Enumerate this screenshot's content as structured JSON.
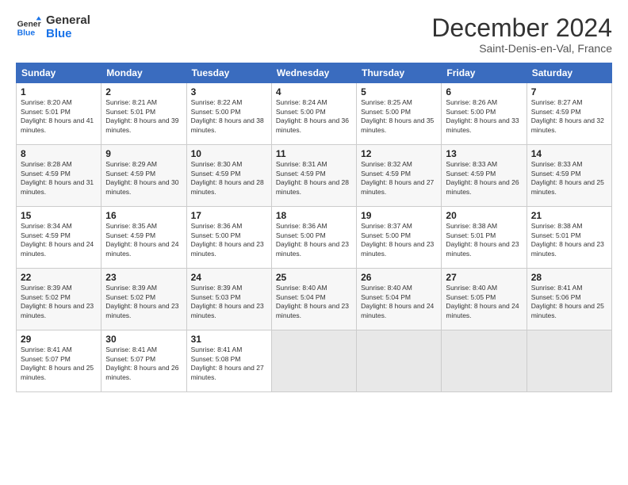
{
  "logo": {
    "line1": "General",
    "line2": "Blue"
  },
  "header": {
    "month": "December 2024",
    "location": "Saint-Denis-en-Val, France"
  },
  "days_of_week": [
    "Sunday",
    "Monday",
    "Tuesday",
    "Wednesday",
    "Thursday",
    "Friday",
    "Saturday"
  ],
  "weeks": [
    [
      {
        "day": "1",
        "sunrise": "8:20 AM",
        "sunset": "5:01 PM",
        "daylight": "8 hours and 41 minutes."
      },
      {
        "day": "2",
        "sunrise": "8:21 AM",
        "sunset": "5:01 PM",
        "daylight": "8 hours and 39 minutes."
      },
      {
        "day": "3",
        "sunrise": "8:22 AM",
        "sunset": "5:00 PM",
        "daylight": "8 hours and 38 minutes."
      },
      {
        "day": "4",
        "sunrise": "8:24 AM",
        "sunset": "5:00 PM",
        "daylight": "8 hours and 36 minutes."
      },
      {
        "day": "5",
        "sunrise": "8:25 AM",
        "sunset": "5:00 PM",
        "daylight": "8 hours and 35 minutes."
      },
      {
        "day": "6",
        "sunrise": "8:26 AM",
        "sunset": "5:00 PM",
        "daylight": "8 hours and 33 minutes."
      },
      {
        "day": "7",
        "sunrise": "8:27 AM",
        "sunset": "4:59 PM",
        "daylight": "8 hours and 32 minutes."
      }
    ],
    [
      {
        "day": "8",
        "sunrise": "8:28 AM",
        "sunset": "4:59 PM",
        "daylight": "8 hours and 31 minutes."
      },
      {
        "day": "9",
        "sunrise": "8:29 AM",
        "sunset": "4:59 PM",
        "daylight": "8 hours and 30 minutes."
      },
      {
        "day": "10",
        "sunrise": "8:30 AM",
        "sunset": "4:59 PM",
        "daylight": "8 hours and 28 minutes."
      },
      {
        "day": "11",
        "sunrise": "8:31 AM",
        "sunset": "4:59 PM",
        "daylight": "8 hours and 28 minutes."
      },
      {
        "day": "12",
        "sunrise": "8:32 AM",
        "sunset": "4:59 PM",
        "daylight": "8 hours and 27 minutes."
      },
      {
        "day": "13",
        "sunrise": "8:33 AM",
        "sunset": "4:59 PM",
        "daylight": "8 hours and 26 minutes."
      },
      {
        "day": "14",
        "sunrise": "8:33 AM",
        "sunset": "4:59 PM",
        "daylight": "8 hours and 25 minutes."
      }
    ],
    [
      {
        "day": "15",
        "sunrise": "8:34 AM",
        "sunset": "4:59 PM",
        "daylight": "8 hours and 24 minutes."
      },
      {
        "day": "16",
        "sunrise": "8:35 AM",
        "sunset": "4:59 PM",
        "daylight": "8 hours and 24 minutes."
      },
      {
        "day": "17",
        "sunrise": "8:36 AM",
        "sunset": "5:00 PM",
        "daylight": "8 hours and 23 minutes."
      },
      {
        "day": "18",
        "sunrise": "8:36 AM",
        "sunset": "5:00 PM",
        "daylight": "8 hours and 23 minutes."
      },
      {
        "day": "19",
        "sunrise": "8:37 AM",
        "sunset": "5:00 PM",
        "daylight": "8 hours and 23 minutes."
      },
      {
        "day": "20",
        "sunrise": "8:38 AM",
        "sunset": "5:01 PM",
        "daylight": "8 hours and 23 minutes."
      },
      {
        "day": "21",
        "sunrise": "8:38 AM",
        "sunset": "5:01 PM",
        "daylight": "8 hours and 23 minutes."
      }
    ],
    [
      {
        "day": "22",
        "sunrise": "8:39 AM",
        "sunset": "5:02 PM",
        "daylight": "8 hours and 23 minutes."
      },
      {
        "day": "23",
        "sunrise": "8:39 AM",
        "sunset": "5:02 PM",
        "daylight": "8 hours and 23 minutes."
      },
      {
        "day": "24",
        "sunrise": "8:39 AM",
        "sunset": "5:03 PM",
        "daylight": "8 hours and 23 minutes."
      },
      {
        "day": "25",
        "sunrise": "8:40 AM",
        "sunset": "5:04 PM",
        "daylight": "8 hours and 23 minutes."
      },
      {
        "day": "26",
        "sunrise": "8:40 AM",
        "sunset": "5:04 PM",
        "daylight": "8 hours and 24 minutes."
      },
      {
        "day": "27",
        "sunrise": "8:40 AM",
        "sunset": "5:05 PM",
        "daylight": "8 hours and 24 minutes."
      },
      {
        "day": "28",
        "sunrise": "8:41 AM",
        "sunset": "5:06 PM",
        "daylight": "8 hours and 25 minutes."
      }
    ],
    [
      {
        "day": "29",
        "sunrise": "8:41 AM",
        "sunset": "5:07 PM",
        "daylight": "8 hours and 25 minutes."
      },
      {
        "day": "30",
        "sunrise": "8:41 AM",
        "sunset": "5:07 PM",
        "daylight": "8 hours and 26 minutes."
      },
      {
        "day": "31",
        "sunrise": "8:41 AM",
        "sunset": "5:08 PM",
        "daylight": "8 hours and 27 minutes."
      },
      null,
      null,
      null,
      null
    ]
  ]
}
